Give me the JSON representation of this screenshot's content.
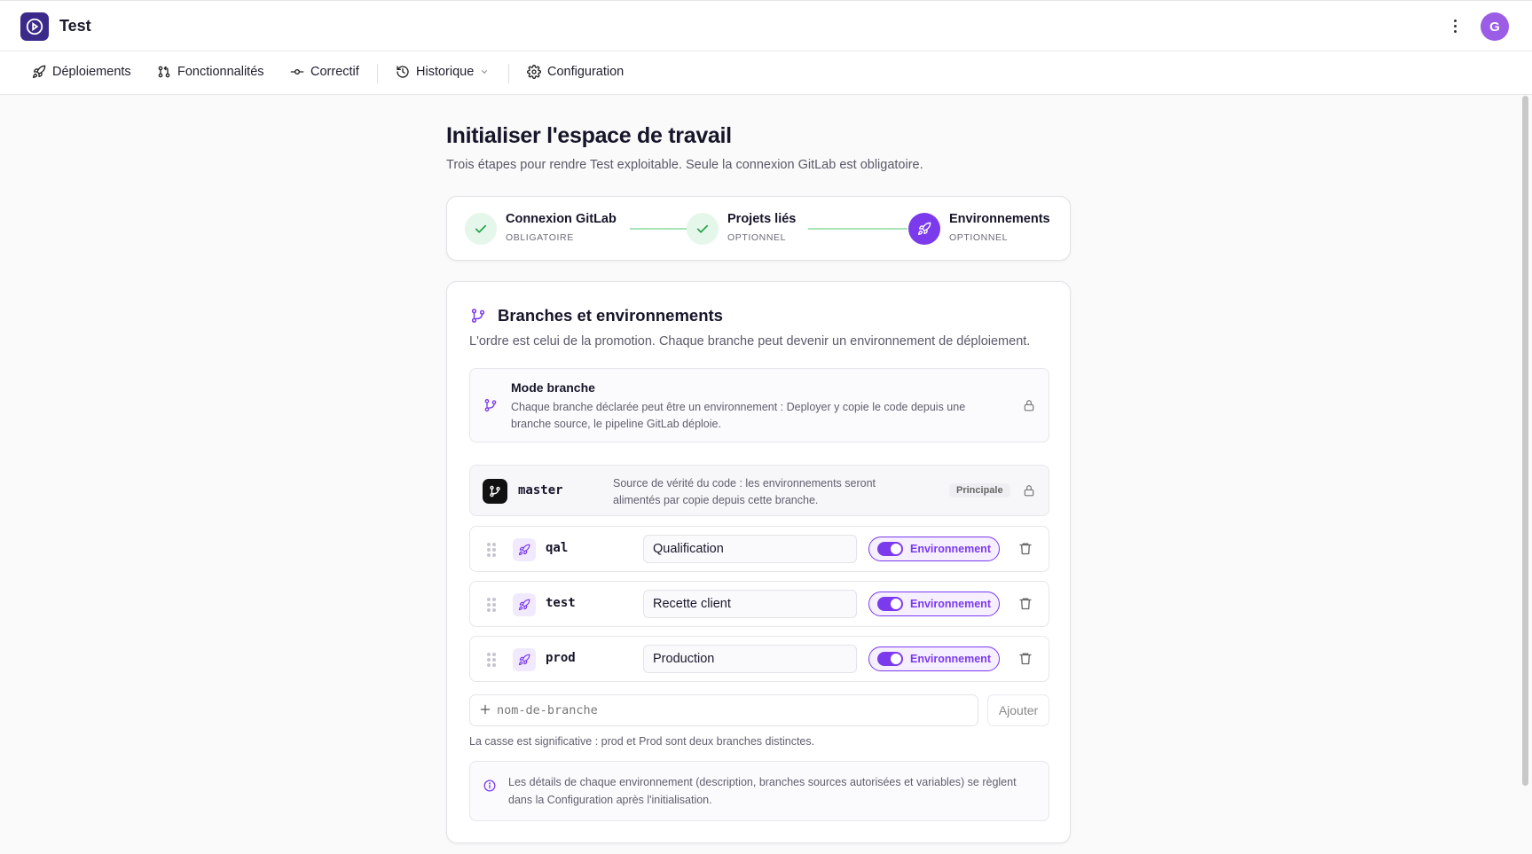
{
  "app": {
    "title": "Test",
    "avatar_initial": "G"
  },
  "nav": {
    "items": [
      {
        "label": "Déploiements",
        "icon": "rocket-icon"
      },
      {
        "label": "Fonctionnalités",
        "icon": "git-pull-request-icon"
      },
      {
        "label": "Correctif",
        "icon": "git-commit-icon"
      },
      {
        "label": "Historique",
        "icon": "history-icon"
      },
      {
        "label": "Configuration",
        "icon": "gear-icon"
      }
    ]
  },
  "page": {
    "title": "Initialiser l'espace de travail",
    "subtitle": "Trois étapes pour rendre Test exploitable. Seule la connexion GitLab est obligatoire."
  },
  "steps": [
    {
      "title": "Connexion GitLab",
      "tag": "OBLIGATOIRE",
      "state": "done"
    },
    {
      "title": "Projets liés",
      "tag": "OPTIONNEL",
      "state": "done"
    },
    {
      "title": "Environnements",
      "tag": "OPTIONNEL",
      "state": "active"
    }
  ],
  "card": {
    "title": "Branches et environnements",
    "subtitle": "L'ordre est celui de la promotion. Chaque branche peut devenir un environnement de déploiement.",
    "mode": {
      "title": "Mode branche",
      "desc": "Chaque branche déclarée peut être un environnement : Deployer y copie le code depuis une branche source, le pipeline GitLab déploie."
    },
    "master": {
      "name": "master",
      "desc": "Source de vérité du code : les environnements seront alimentés par copie depuis cette branche.",
      "badge": "Principale"
    },
    "envs": [
      {
        "branch": "qal",
        "label": "Qualification",
        "toggle_label": "Environnement",
        "enabled": true
      },
      {
        "branch": "test",
        "label": "Recette client",
        "toggle_label": "Environnement",
        "enabled": true
      },
      {
        "branch": "prod",
        "label": "Production",
        "toggle_label": "Environnement",
        "enabled": true
      }
    ],
    "add": {
      "placeholder": "nom-de-branche",
      "button": "Ajouter"
    },
    "case_note": "La casse est significative : prod et Prod sont deux branches distinctes.",
    "info": "Les détails de chaque environnement (description, branches sources autorisées et variables) se règlent dans la Configuration après l'initialisation."
  },
  "colors": {
    "accent": "#7c3aed",
    "success": "#22a34a",
    "logo_bg": "#3b2a8a"
  }
}
